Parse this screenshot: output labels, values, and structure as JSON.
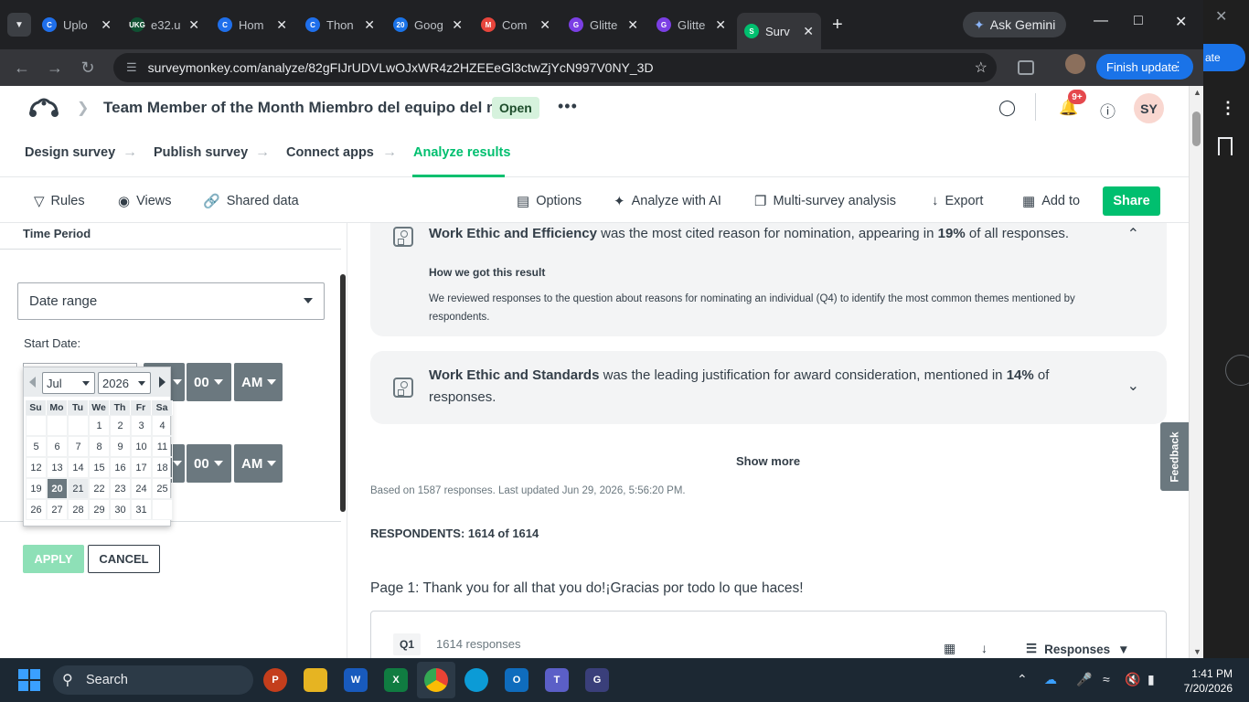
{
  "browser": {
    "tabs": [
      {
        "label": "Uplo",
        "fav_color": "#1f6feb",
        "fav": "C"
      },
      {
        "label": "e32.u",
        "fav_color": "#0f5132",
        "fav": "UKG"
      },
      {
        "label": "Hom",
        "fav_color": "#1f6feb",
        "fav": "C"
      },
      {
        "label": "Thon",
        "fav_color": "#1f6feb",
        "fav": "C"
      },
      {
        "label": "Goog",
        "fav_color": "#1a73e8",
        "fav": "20"
      },
      {
        "label": "Com",
        "fav_color": "#e8453c",
        "fav": "M"
      },
      {
        "label": "Glitte",
        "fav_color": "#7b3fe4",
        "fav": "G"
      },
      {
        "label": "Glitte",
        "fav_color": "#7b3fe4",
        "fav": "G"
      },
      {
        "label": "Surv",
        "fav_color": "#00bf6f",
        "fav": "S"
      }
    ],
    "ask_gemini": "Ask Gemini",
    "url": "surveymonkey.com/analyze/82gFIJrUDVLwOJxWR4z2HZEEeGl3ctwZjYcN997V0NY_3D",
    "finish_update": "Finish update",
    "side_update": "ate"
  },
  "header": {
    "survey_title": "Team Member of the Month Miembro del equipo del mes",
    "status": "Open",
    "notification_count": "9+",
    "avatar_initials": "SY"
  },
  "steps": [
    "Design survey",
    "Publish survey",
    "Connect apps",
    "Analyze results"
  ],
  "actionbar": {
    "rules": "Rules",
    "views": "Views",
    "shared_data": "Shared data",
    "options": "Options",
    "analyze_ai": "Analyze with AI",
    "multi_survey": "Multi-survey analysis",
    "export": "Export",
    "add_to": "Add to",
    "share": "Share"
  },
  "filter_panel": {
    "title": "Time Period",
    "range_select": "Date range",
    "start_date_label": "Start Date:",
    "minute_1": "00",
    "ampm_1": "AM",
    "minute_2": "00",
    "ampm_2": "AM",
    "apply": "APPLY",
    "cancel": "CANCEL"
  },
  "calendar": {
    "month": "Jul",
    "year": "2026",
    "weekdays": [
      "Su",
      "Mo",
      "Tu",
      "We",
      "Th",
      "Fr",
      "Sa"
    ],
    "leading_blanks": 3,
    "days_in_month": 31,
    "selected_day": 20
  },
  "insights": {
    "card1_bold": "Work Ethic and Efficiency",
    "card1_rest": " was the most cited reason for nomination, appearing in ",
    "card1_pct": "19%",
    "card1_end": " of all responses.",
    "how_title": "How we got this result",
    "how_text": "We reviewed responses to the question about reasons for nominating an individual (Q4) to identify the most common themes mentioned by respondents.",
    "card2_bold": "Work Ethic and Standards",
    "card2_rest": " was the leading justification for award consideration, mentioned in ",
    "card2_pct": "14%",
    "card2_end": " of responses.",
    "show_more": "Show more",
    "based_on": "Based on 1587 responses. Last updated Jun 29, 2026, 5:56:20 PM."
  },
  "results": {
    "respondents": "RESPONDENTS: 1614 of 1614",
    "page_title": "Page 1: Thank you for all that you do!¡Gracias por todo lo que haces!",
    "q_label": "Q1",
    "q_count": "1614 responses",
    "responses_btn": "Responses"
  },
  "feedback": "Feedback",
  "taskbar": {
    "search": "Search",
    "time": "1:41 PM",
    "date": "7/20/2026"
  }
}
